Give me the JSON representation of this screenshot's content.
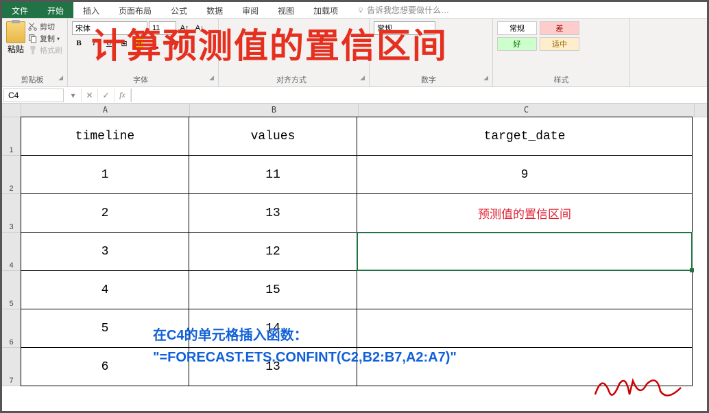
{
  "tabs": {
    "file": "文件",
    "home": "开始",
    "insert": "插入",
    "layout": "页面布局",
    "formulas": "公式",
    "data": "数据",
    "review": "审阅",
    "view": "视图",
    "addins": "加载项",
    "tell_me": "告诉我您想要做什么…"
  },
  "ribbon": {
    "clipboard": {
      "label": "剪贴板",
      "paste": "粘贴",
      "cut": "剪切",
      "copy": "复制",
      "format_painter": "格式刷"
    },
    "font": {
      "label": "字体",
      "name": "宋体",
      "size": "11",
      "bold": "B",
      "italic": "I",
      "underline": "U"
    },
    "align": {
      "label": "对齐方式"
    },
    "number": {
      "label": "数字",
      "format": "常规"
    },
    "style": {
      "label": "样式",
      "normal": "常规",
      "bad": "差",
      "good": "好",
      "neutral": "适中"
    }
  },
  "formula_bar": {
    "name_box": "C4",
    "fx": "fx",
    "formula": ""
  },
  "columns": [
    "A",
    "B",
    "C"
  ],
  "rows": [
    {
      "n": "1",
      "A": "timeline",
      "B": "values",
      "C": "target_date"
    },
    {
      "n": "2",
      "A": "1",
      "B": "11",
      "C": "9"
    },
    {
      "n": "3",
      "A": "2",
      "B": "13",
      "C": "预测值的置信区间"
    },
    {
      "n": "4",
      "A": "3",
      "B": "12",
      "C": ""
    },
    {
      "n": "5",
      "A": "4",
      "B": "15",
      "C": ""
    },
    {
      "n": "6",
      "A": "5",
      "B": "14",
      "C": ""
    },
    {
      "n": "7",
      "A": "6",
      "B": "13",
      "C": ""
    }
  ],
  "overlay": {
    "title": "计算预测值的置信区间",
    "annot_line1": "在C4的单元格插入函数：",
    "annot_line2": "\"=FORECAST.ETS.CONFINT(C2,B2:B7,A2:A7)\""
  },
  "selected_cell": "C4"
}
